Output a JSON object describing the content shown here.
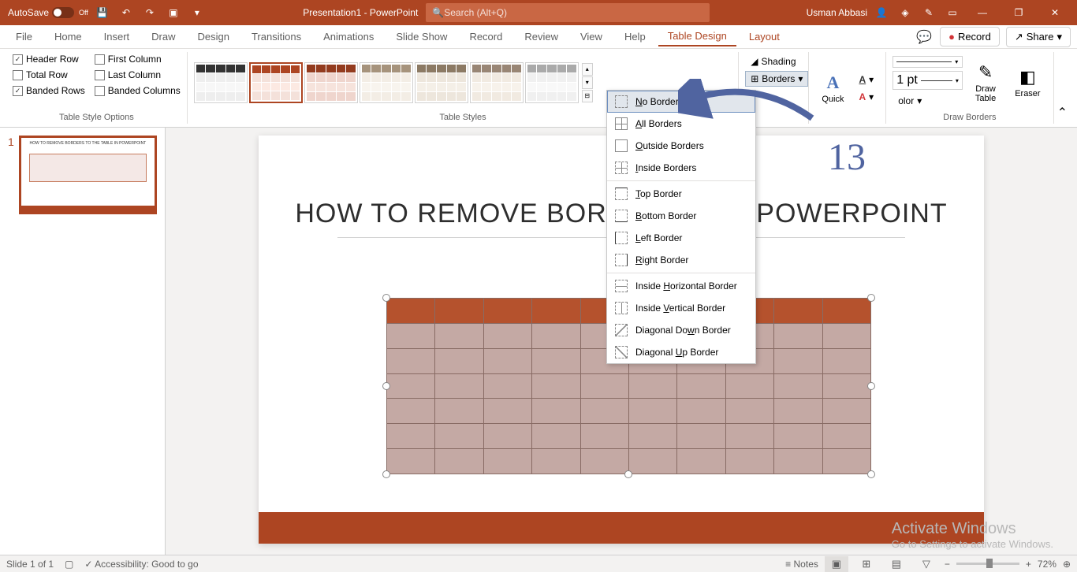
{
  "titleBar": {
    "autosave": "AutoSave",
    "autosaveOff": "Off",
    "docTitle": "Presentation1 - PowerPoint",
    "searchPlaceholder": "Search (Alt+Q)",
    "userName": "Usman Abbasi"
  },
  "tabs": {
    "file": "File",
    "home": "Home",
    "insert": "Insert",
    "draw": "Draw",
    "design": "Design",
    "transitions": "Transitions",
    "animations": "Animations",
    "slideshow": "Slide Show",
    "record": "Record",
    "review": "Review",
    "view": "View",
    "help": "Help",
    "tableDesign": "Table Design",
    "layout": "Layout",
    "recordBtn": "Record",
    "shareBtn": "Share"
  },
  "ribbon": {
    "headerRow": "Header Row",
    "totalRow": "Total Row",
    "bandedRows": "Banded Rows",
    "firstCol": "First Column",
    "lastCol": "Last Column",
    "bandedCols": "Banded Columns",
    "tableStyleOptions": "Table Style Options",
    "tableStyles": "Table Styles",
    "shading": "Shading",
    "borders": "Borders",
    "quickStyles": "Quick",
    "penWeight": "1 pt",
    "penColor": "olor",
    "drawTableTop": "Draw",
    "drawTableBottom": "Table",
    "eraser": "Eraser",
    "drawBorders": "Draw Borders"
  },
  "dropdown": {
    "noBorder": "o Border",
    "allBorders": "ll Borders",
    "outsideBorders": "utside Borders",
    "insideBorders": "nside Borders",
    "topBorder": "op Border",
    "bottomBorder": "ottom Border",
    "leftBorder": "eft Border",
    "rightBorder": "ight Border",
    "insideHorizontal": "orizontal Border",
    "insideHorizontalPrefix": "Inside ",
    "insideVertical": "ertical Border",
    "insideVerticalPrefix": "Inside ",
    "diagonalDown": "n Border",
    "diagonalDownPrefix": "Diagonal Do",
    "diagonalUp": "p Border",
    "diagonalUpPrefix": "Diagonal "
  },
  "slide": {
    "number": "1",
    "title": "HOW TO REMOVE BORDERS                E IN POWERPOINT",
    "thumbTitle": "HOW TO REMOVE BORDERS TO THE TABLE IN POWERPOINT"
  },
  "status": {
    "slideInfo": "Slide 1 of 1",
    "accessibility": "Accessibility: Good to go",
    "notes": "Notes",
    "zoom": "72%"
  },
  "activate": {
    "title": "Activate Windows",
    "sub": "Go to Settings to activate Windows."
  },
  "annotation": {
    "number": "13"
  }
}
